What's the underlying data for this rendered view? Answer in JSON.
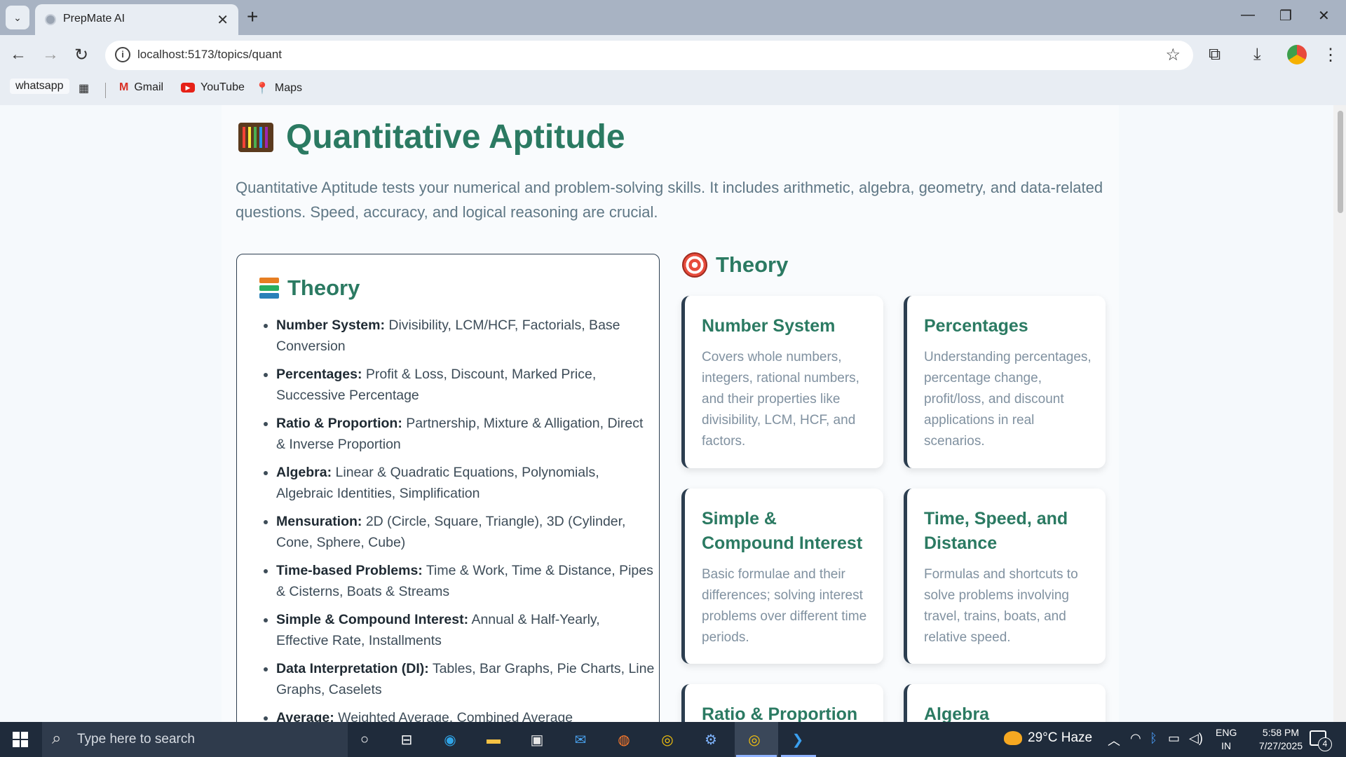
{
  "browser": {
    "tab_title": "PrepMate AI",
    "url": "localhost:5173/topics/quant",
    "bookmarks": [
      "whatsapp",
      "Gmail",
      "YouTube",
      "Maps"
    ]
  },
  "page": {
    "title": "Quantitative Aptitude",
    "intro": "Quantitative Aptitude tests your numerical and problem-solving skills. It includes arithmetic, algebra, geometry, and data-related questions. Speed, accuracy, and logical reasoning are crucial.",
    "theory_card": {
      "heading": "Theory",
      "items": [
        {
          "label": "Number System:",
          "text": " Divisibility, LCM/HCF, Factorials, Base Conversion"
        },
        {
          "label": "Percentages:",
          "text": " Profit & Loss, Discount, Marked Price, Successive Percentage"
        },
        {
          "label": "Ratio & Proportion:",
          "text": " Partnership, Mixture & Alligation, Direct & Inverse Proportion"
        },
        {
          "label": "Algebra:",
          "text": " Linear & Quadratic Equations, Polynomials, Algebraic Identities, Simplification"
        },
        {
          "label": "Mensuration:",
          "text": " 2D (Circle, Square, Triangle), 3D (Cylinder, Cone, Sphere, Cube)"
        },
        {
          "label": "Time-based Problems:",
          "text": " Time & Work, Time & Distance, Pipes & Cisterns, Boats & Streams"
        },
        {
          "label": "Simple & Compound Interest:",
          "text": " Annual & Half-Yearly, Effective Rate, Installments"
        },
        {
          "label": "Data Interpretation (DI):",
          "text": " Tables, Bar Graphs, Pie Charts, Line Graphs, Caselets"
        },
        {
          "label": "Average:",
          "text": " Weighted Average, Combined Average"
        }
      ]
    },
    "right_heading": "Theory",
    "topic_cards": [
      {
        "title": "Number System",
        "desc": "Covers whole numbers, integers, rational numbers, and their properties like divisibility, LCM, HCF, and factors."
      },
      {
        "title": "Percentages",
        "desc": "Understanding percentages, percentage change, profit/loss, and discount applications in real scenarios."
      },
      {
        "title": "Simple & Compound Interest",
        "desc": "Basic formulae and their differences; solving interest problems over different time periods."
      },
      {
        "title": "Time, Speed, and Distance",
        "desc": "Formulas and shortcuts to solve problems involving travel, trains, boats, and relative speed."
      },
      {
        "title": "Ratio & Proportion",
        "desc": ""
      },
      {
        "title": "Algebra",
        "desc": ""
      }
    ]
  },
  "taskbar": {
    "search_placeholder": "Type here to search",
    "weather": "29°C  Haze",
    "lang_line1": "ENG",
    "lang_line2": "IN",
    "time": "5:58 PM",
    "date": "7/27/2025",
    "notification_count": "4"
  }
}
